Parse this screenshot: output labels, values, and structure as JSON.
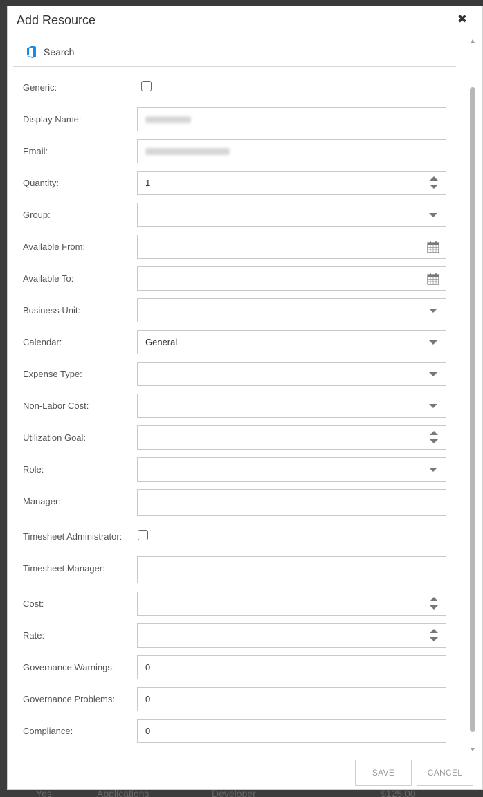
{
  "dialog": {
    "title": "Add Resource",
    "close_icon": "close-icon"
  },
  "search": {
    "icon": "office-logo-icon",
    "label": "Search",
    "accent_color": "#1e88e5"
  },
  "form": {
    "generic": {
      "label": "Generic:",
      "checked": false
    },
    "display_name": {
      "label": "Display Name:",
      "value_note": "blurred"
    },
    "email": {
      "label": "Email:",
      "value_note": "blurred"
    },
    "quantity": {
      "label": "Quantity:",
      "value": "1"
    },
    "group": {
      "label": "Group:",
      "value": ""
    },
    "available_from": {
      "label": "Available From:",
      "value": ""
    },
    "available_to": {
      "label": "Available To:",
      "value": ""
    },
    "business_unit": {
      "label": "Business Unit:",
      "value": ""
    },
    "calendar": {
      "label": "Calendar:",
      "value": "General"
    },
    "expense_type": {
      "label": "Expense Type:",
      "value": ""
    },
    "non_labor_cost": {
      "label": "Non-Labor Cost:",
      "value": ""
    },
    "utilization_goal": {
      "label": "Utilization Goal:",
      "value": ""
    },
    "role": {
      "label": "Role:",
      "value": ""
    },
    "manager": {
      "label": "Manager:",
      "value": ""
    },
    "timesheet_administrator": {
      "label": "Timesheet Administrator:",
      "checked": false
    },
    "timesheet_manager": {
      "label": "Timesheet Manager:",
      "value": ""
    },
    "cost": {
      "label": "Cost:",
      "value": ""
    },
    "rate": {
      "label": "Rate:",
      "value": ""
    },
    "governance_warnings": {
      "label": "Governance Warnings:",
      "value": "0"
    },
    "governance_problems": {
      "label": "Governance Problems:",
      "value": "0"
    },
    "compliance": {
      "label": "Compliance:",
      "value": "0"
    }
  },
  "footer": {
    "save_label": "SAVE",
    "cancel_label": "CANCEL"
  },
  "background_row": {
    "col1": "Yes",
    "col2": "Applications",
    "col3": "Developer",
    "col4": "$125.00"
  }
}
